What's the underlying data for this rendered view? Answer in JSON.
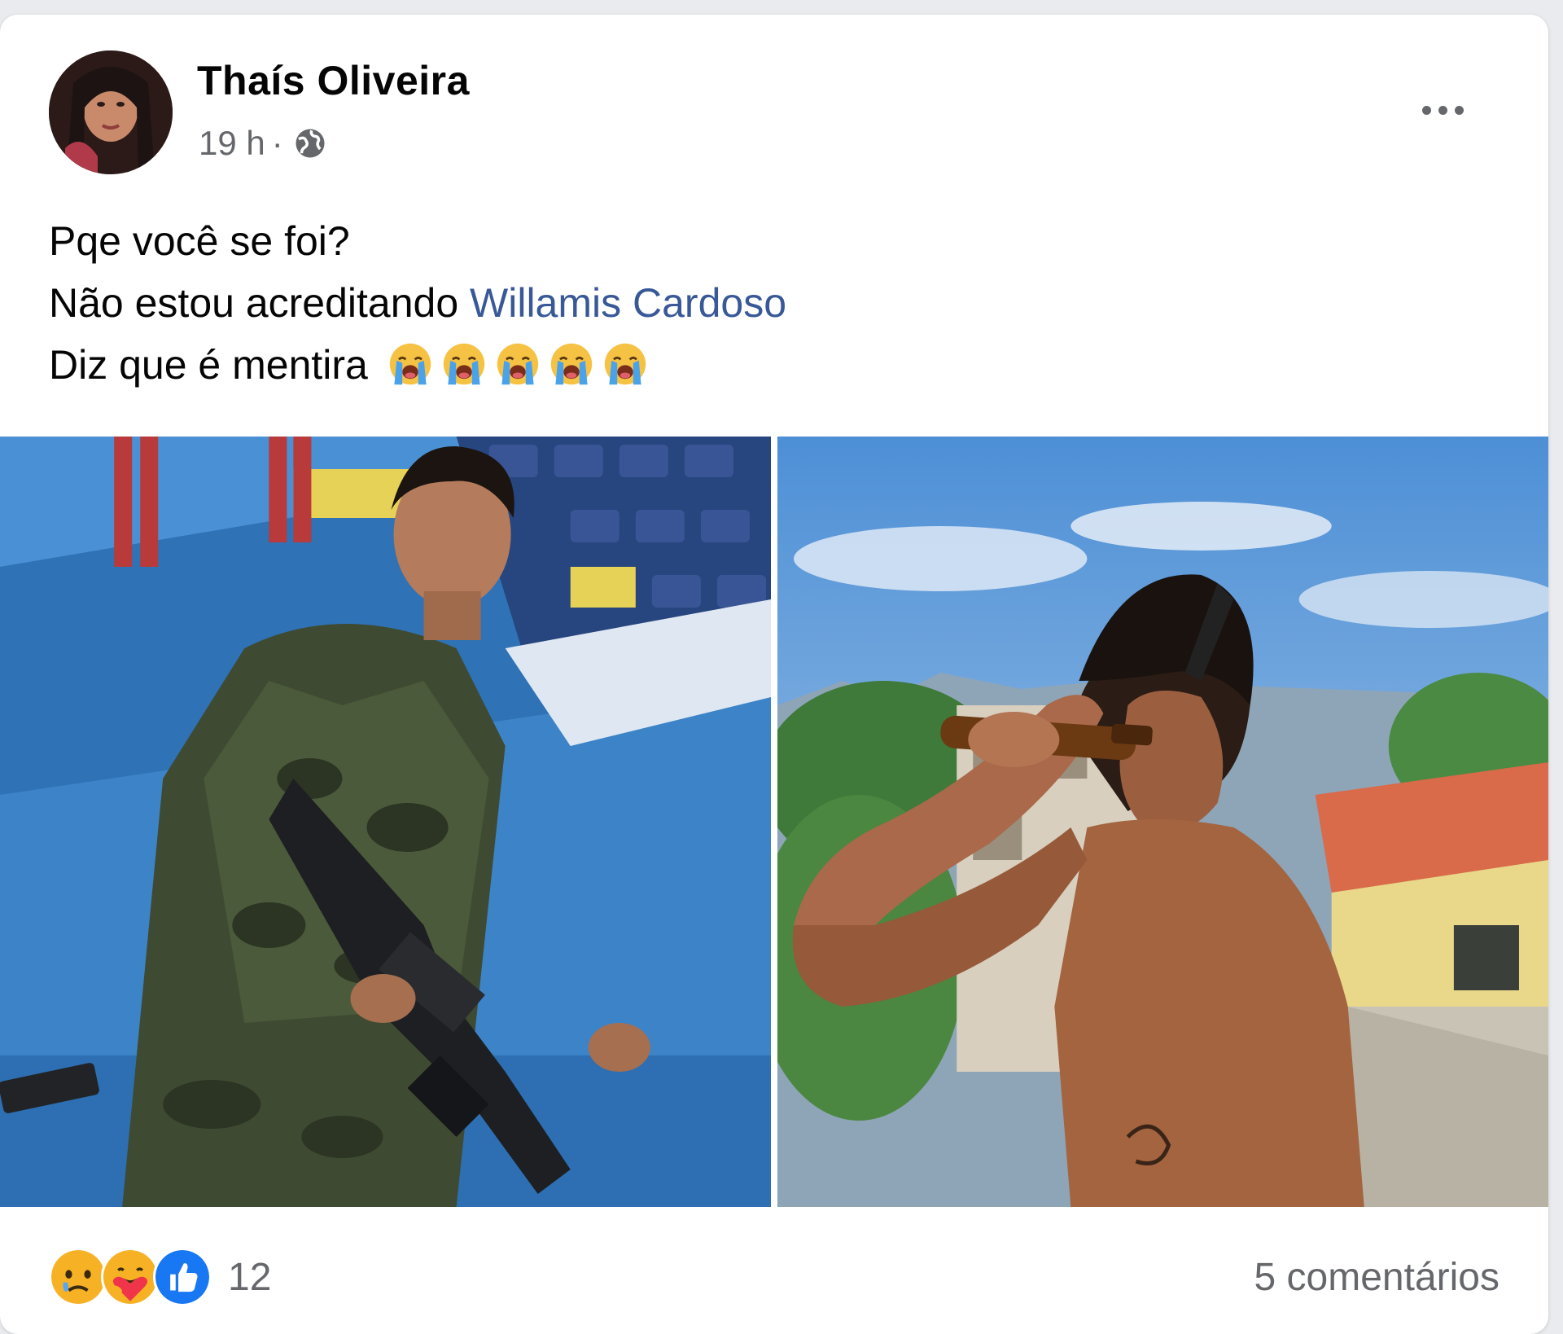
{
  "post": {
    "author": "Thaís Oliveira",
    "time": "19 h",
    "separator": "·",
    "audience_icon": "globe-icon",
    "more_icon": "more-options-icon",
    "text": {
      "line1": "Pqe você se foi?",
      "line2_prefix": "Não estou acreditando ",
      "line2_mention": "Willamis Cardoso",
      "line3": "Diz que é mentira",
      "line3_emoji": [
        "loudly-crying-face-emoji",
        "loudly-crying-face-emoji",
        "loudly-crying-face-emoji",
        "loudly-crying-face-emoji",
        "loudly-crying-face-emoji"
      ]
    },
    "photos": [
      {
        "name": "photo-soldier-with-rifle"
      },
      {
        "name": "photo-shirtless-man-drinking"
      }
    ],
    "reactions": {
      "icons": [
        "sad-reaction-icon",
        "care-reaction-icon",
        "like-reaction-icon"
      ],
      "count": "12"
    },
    "comments_label": "5 comentários"
  },
  "colors": {
    "mention": "#385898",
    "secondary_text": "#65676b",
    "like_blue": "#1877f2"
  }
}
